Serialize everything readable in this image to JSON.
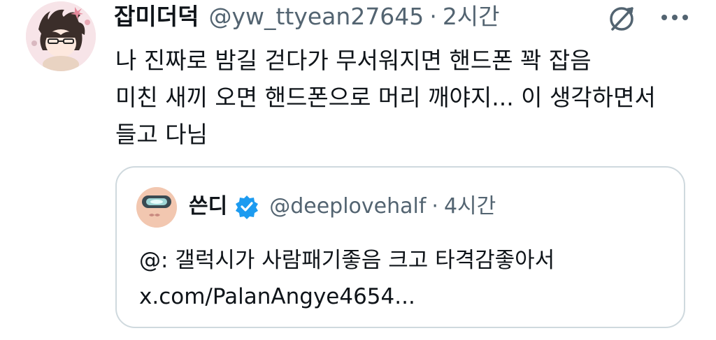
{
  "tweet": {
    "display_name": "잡미더덕",
    "handle": "@yw_ttyean27645",
    "separator": "·",
    "time": "2시간",
    "text_lines": [
      "나 진짜로 밤길 걷다가 무서워지면 핸드폰 꽉 잡음",
      "미친 새끼 오면 핸드폰으로 머리 깨야지... 이 생각하면서",
      "들고 다님"
    ]
  },
  "actions": {
    "grok_icon": "grok-icon",
    "more_icon": "more-icon"
  },
  "quote": {
    "display_name": "쓴디",
    "verified_icon": "verified-badge-icon",
    "handle": "@deeplovehalf",
    "separator": "·",
    "time": "4시간",
    "text_lines": [
      "@: 갤럭시가 사람패기좋음 크고 타격감좋아서",
      "x.com/PalanAngye4654..."
    ]
  },
  "colors": {
    "text": "#0f1419",
    "secondary": "#536471",
    "border": "#cfd9de",
    "verified": "#1d9bf0"
  }
}
